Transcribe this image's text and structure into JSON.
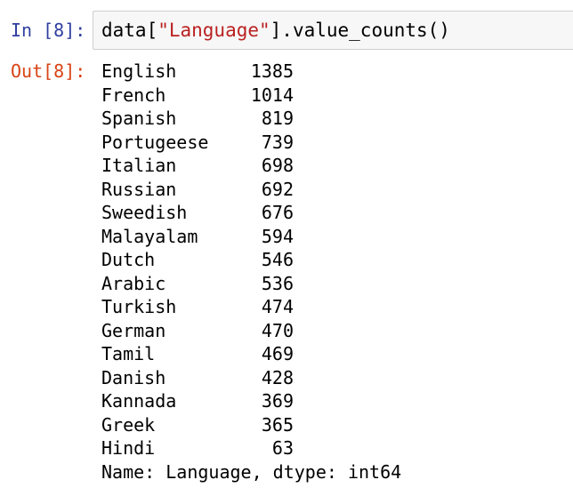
{
  "cell": {
    "in_prompt": "In [8]:",
    "code": {
      "prefix": "data[",
      "string": "\"Language\"",
      "suffix": "].value_counts()"
    },
    "out_prompt": "Out[8]:",
    "output": {
      "rows": [
        {
          "label": "English",
          "count": "1385"
        },
        {
          "label": "French",
          "count": "1014"
        },
        {
          "label": "Spanish",
          "count": "819"
        },
        {
          "label": "Portugeese",
          "count": "739"
        },
        {
          "label": "Italian",
          "count": "698"
        },
        {
          "label": "Russian",
          "count": "692"
        },
        {
          "label": "Sweedish",
          "count": "676"
        },
        {
          "label": "Malayalam",
          "count": "594"
        },
        {
          "label": "Dutch",
          "count": "546"
        },
        {
          "label": "Arabic",
          "count": "536"
        },
        {
          "label": "Turkish",
          "count": "474"
        },
        {
          "label": "German",
          "count": "470"
        },
        {
          "label": "Tamil",
          "count": "469"
        },
        {
          "label": "Danish",
          "count": "428"
        },
        {
          "label": "Kannada",
          "count": "369"
        },
        {
          "label": "Greek",
          "count": "365"
        },
        {
          "label": "Hindi",
          "count": "63"
        }
      ],
      "footer": "Name: Language, dtype: int64"
    }
  },
  "colors": {
    "in_prompt": "#303f9f",
    "out_prompt": "#d84315",
    "string": "#ba2121",
    "input_background": "#f7f7f7",
    "input_border": "#cfcfcf"
  }
}
